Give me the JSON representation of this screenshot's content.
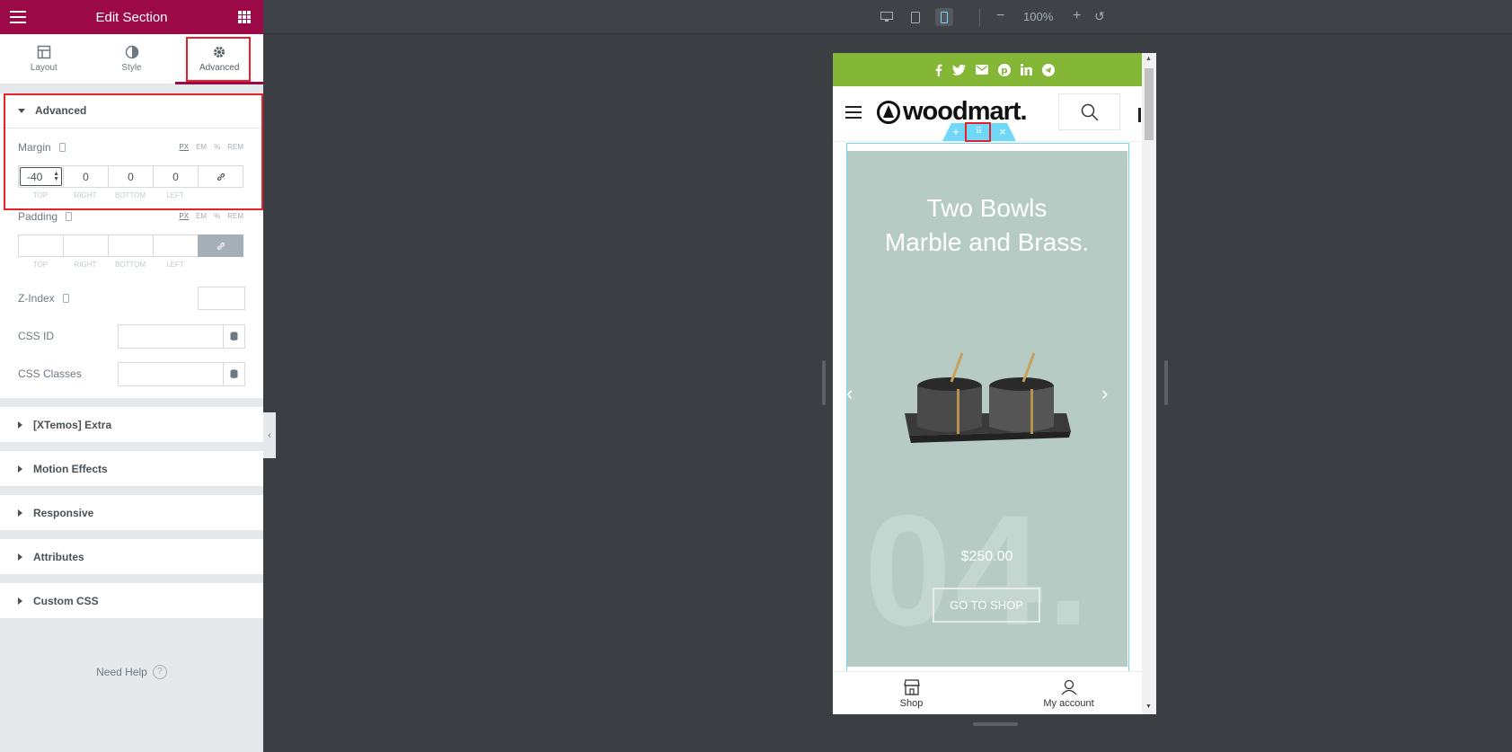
{
  "panel": {
    "title": "Edit Section",
    "tabs": [
      {
        "label": "Layout",
        "icon": "layout-icon"
      },
      {
        "label": "Style",
        "icon": "style-icon"
      },
      {
        "label": "Advanced",
        "icon": "gear-icon",
        "active": true
      }
    ],
    "advanced": {
      "heading": "Advanced",
      "margin": {
        "label": "Margin",
        "units": [
          "PX",
          "EM",
          "%",
          "REM"
        ],
        "selected_unit": "PX",
        "values": {
          "top": "-40",
          "right": "0",
          "bottom": "0",
          "left": "0"
        },
        "side_labels": [
          "TOP",
          "RIGHT",
          "BOTTOM",
          "LEFT"
        ]
      },
      "padding": {
        "label": "Padding",
        "units": [
          "PX",
          "EM",
          "%",
          "REM"
        ],
        "selected_unit": "PX",
        "side_labels": [
          "TOP",
          "RIGHT",
          "BOTTOM",
          "LEFT"
        ]
      },
      "z_index_label": "Z-Index",
      "css_id_label": "CSS ID",
      "css_classes_label": "CSS Classes"
    },
    "sections": [
      "[XTemos] Extra",
      "Motion Effects",
      "Responsive",
      "Attributes",
      "Custom CSS"
    ],
    "need_help": "Need Help",
    "need_help_icon": "?"
  },
  "topbar": {
    "devices": [
      "desktop-icon",
      "tablet-icon",
      "mobile-icon"
    ],
    "active_device": "mobile",
    "zoom": "100%"
  },
  "preview": {
    "social_icons": [
      "facebook-icon",
      "twitter-icon",
      "email-icon",
      "pinterest-icon",
      "linkedin-icon",
      "telegram-icon"
    ],
    "logo_text": "woodmart.",
    "slide": {
      "title_line1": "Two Bowls",
      "title_line2": "Marble and Brass.",
      "price": "$250.00",
      "cta": "GO TO SHOP",
      "big_number": "04."
    },
    "bottom_nav": [
      {
        "label": "Shop",
        "icon": "shop-icon"
      },
      {
        "label": "My account",
        "icon": "user-icon"
      }
    ]
  },
  "colors": {
    "brand": "#9b0a46",
    "highlight": "#e8202a",
    "social_bar": "#83b735",
    "slide_bg": "#b5cbc3",
    "section_outline": "#71d7f7"
  }
}
